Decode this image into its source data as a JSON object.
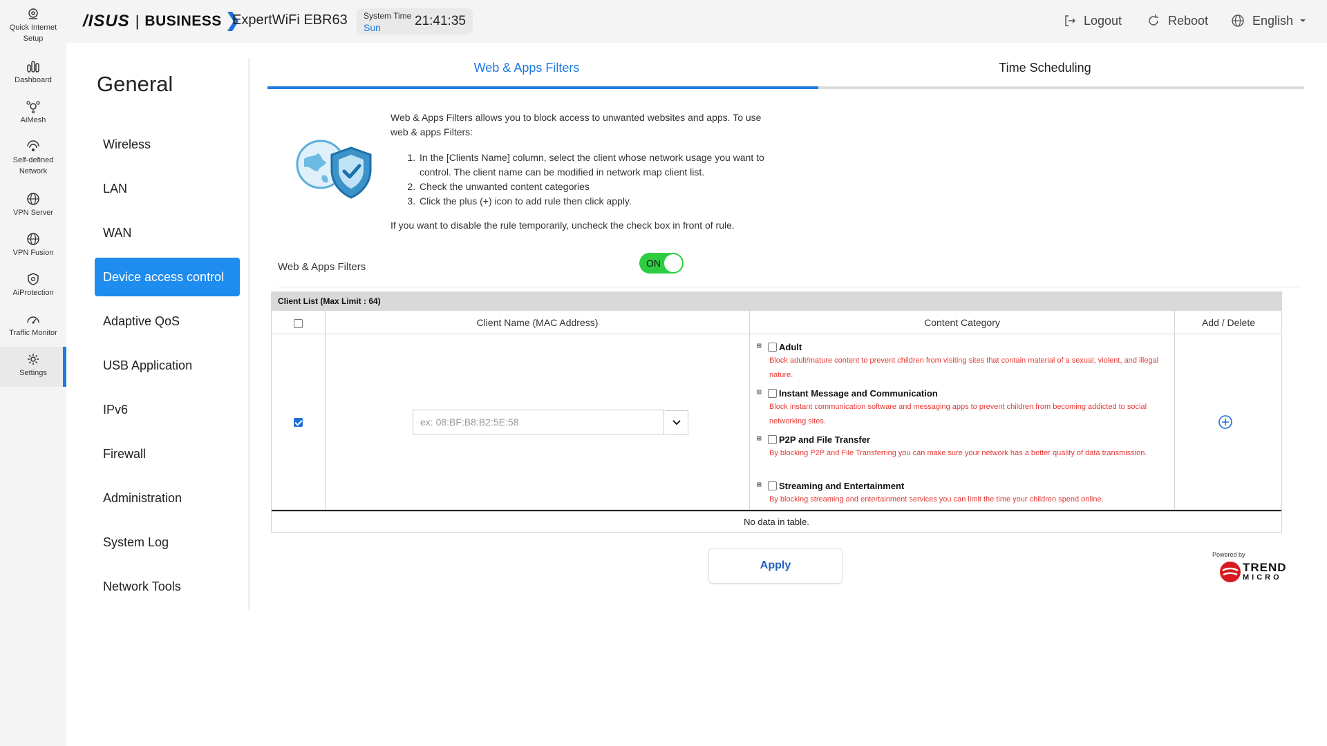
{
  "rail": {
    "items": [
      {
        "label": "Quick Internet Setup",
        "icon": "setup-icon"
      },
      {
        "label": "Dashboard",
        "icon": "dashboard-icon"
      },
      {
        "label": "AiMesh",
        "icon": "aimesh-icon"
      },
      {
        "label": "Self-defined Network",
        "icon": "network-icon"
      },
      {
        "label": "VPN Server",
        "icon": "globe-icon"
      },
      {
        "label": "VPN Fusion",
        "icon": "globe-icon"
      },
      {
        "label": "AiProtection",
        "icon": "shield-icon"
      },
      {
        "label": "Traffic Monitor",
        "icon": "gauge-icon"
      },
      {
        "label": "Settings",
        "icon": "gear-icon"
      }
    ],
    "active_index": 8
  },
  "header": {
    "brand_asus": "/ISUS",
    "brand_sep": "|",
    "brand_business": "BUSINESS",
    "model": "ExpertWiFi EBR63",
    "system_time_label": "System Time",
    "system_day": "Sun",
    "system_clock": "21:41:35",
    "logout": "Logout",
    "reboot": "Reboot",
    "language": "English"
  },
  "secnav": {
    "title": "General",
    "items": [
      "Wireless",
      "LAN",
      "WAN",
      "Device access control",
      "Adaptive QoS",
      "USB Application",
      "IPv6",
      "Firewall",
      "Administration",
      "System Log",
      "Network Tools"
    ],
    "active_index": 3
  },
  "tabs": {
    "items": [
      "Web & Apps Filters",
      "Time Scheduling"
    ],
    "active_index": 0
  },
  "intro": {
    "lead": "Web & Apps Filters allows you to block access to unwanted websites and apps. To use web & apps Filters:",
    "steps": [
      "In the [Clients Name] column, select the client whose network usage you want to control. The client name can be modified in network map client list.",
      "Check the unwanted content categories",
      "Click the plus (+) icon to add rule then click apply."
    ],
    "note": "If you want to disable the rule temporarily, uncheck the check box in front of rule."
  },
  "filter_switch": {
    "label": "Web & Apps Filters",
    "state": "ON"
  },
  "client_list": {
    "title": "Client List (Max Limit : 64)",
    "columns": [
      "Client Name (MAC Address)",
      "Content Category",
      "Add / Delete"
    ],
    "mac_placeholder": "ex: 08:BF:B8:B2:5E:58",
    "categories": [
      {
        "name": "Adult",
        "desc": "Block adult/mature content to prevent children from visiting sites that contain material of a sexual, violent, and illegal nature."
      },
      {
        "name": "Instant Message and Communication",
        "desc": "Block instant communication software and messaging apps to prevent children from becoming addicted to social networking sites."
      },
      {
        "name": "P2P and File Transfer",
        "desc": "By blocking P2P and File Transferring you can make sure your network has a better quality of data transmission."
      },
      {
        "name": "Streaming and Entertainment",
        "desc": "By blocking streaming and entertainment services you can limit the time your children spend online."
      }
    ],
    "empty_text": "No data in table."
  },
  "apply_label": "Apply",
  "trend": {
    "powered_by": "Powered by",
    "line1": "TREND",
    "line2": "MICRO"
  },
  "colors": {
    "accent": "#1f7ae0",
    "active_nav": "#1f8cf0",
    "toggle_on": "#2ecc40",
    "warning_text": "#e53935"
  }
}
